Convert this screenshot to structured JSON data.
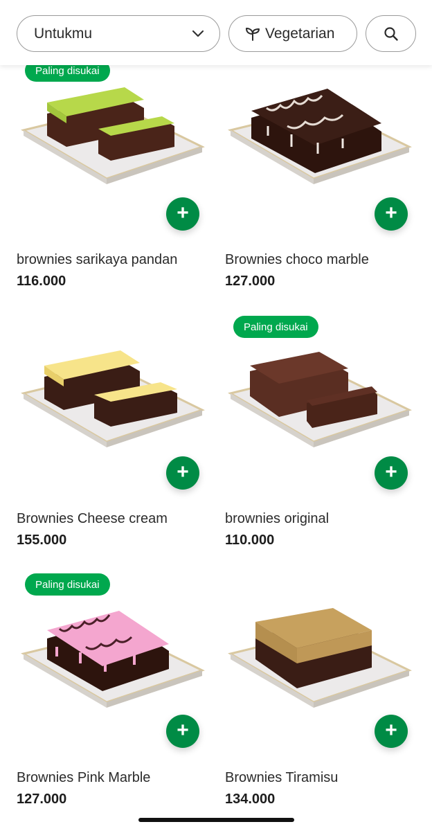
{
  "filters": {
    "selected_category": "Untukmu",
    "vegetarian_label": "Vegetarian"
  },
  "badge_label": "Paling disukai",
  "products": [
    {
      "name": "brownies sarikaya pandan",
      "price": "116.000",
      "badge": true,
      "topping": "#b7d84a",
      "style": "slab"
    },
    {
      "name": "Brownies choco marble",
      "price": "127.000",
      "badge": false,
      "topping": "#3b1e16",
      "style": "marble"
    },
    {
      "name": "Brownies Cheese cream",
      "price": "155.000",
      "badge": false,
      "topping": "#f7e48a",
      "style": "slab"
    },
    {
      "name": "brownies original",
      "price": "110.000",
      "badge": true,
      "topping": "#5a2e22",
      "style": "plain"
    },
    {
      "name": "Brownies Pink Marble",
      "price": "127.000",
      "badge": true,
      "topping": "#f4a6cf",
      "style": "marble"
    },
    {
      "name": "Brownies Tiramisu",
      "price": "134.000",
      "badge": false,
      "topping": "#c7a15e",
      "style": "slab"
    }
  ]
}
